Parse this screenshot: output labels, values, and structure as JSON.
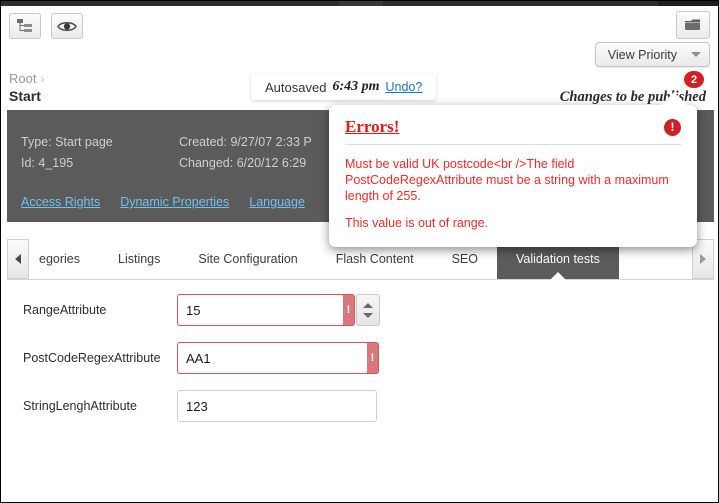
{
  "window": {
    "title": "EPiServer page edit view"
  },
  "toolbar": {
    "tree_button": "tree-structure-icon",
    "preview_button": "eye-icon",
    "folder_button": "folder-icon",
    "collapse_handle": "chevron-down-icon",
    "view_priority": {
      "label": "View Priority",
      "chevron": "chevron-down-icon"
    }
  },
  "breadcrumb": {
    "root": "Root",
    "separator": "›",
    "current": "Start"
  },
  "autosave": {
    "label": "Autosaved",
    "time": "6:43 pm",
    "undo": "Undo?"
  },
  "publish": {
    "status_text": "Changes to be published",
    "badge_count": "2"
  },
  "metadata": {
    "type_label": "Type:",
    "type_value": "Start page",
    "id_label": "Id:",
    "id_value": "4_195",
    "created_label": "Created:",
    "created_value": "9/27/07 2:33 P",
    "changed_label": "Changed:",
    "changed_value": "6/20/12 6:29",
    "links": [
      {
        "label": "Access Rights"
      },
      {
        "label": "Dynamic Properties"
      },
      {
        "label": "Language"
      }
    ]
  },
  "error_popup": {
    "title": "Errors!",
    "icon": "exclamation-icon",
    "messages": [
      "Must be valid UK postcode<br />The field PostCodeRegexAttribute must be a string with a maximum length of 255.",
      "This value is out of range."
    ]
  },
  "tabs": {
    "scroll_left": "arrow-left-icon",
    "scroll_right": "arrow-right-icon",
    "items": [
      {
        "label": "egories",
        "active": false
      },
      {
        "label": "Listings",
        "active": false
      },
      {
        "label": "Site Configuration",
        "active": false
      },
      {
        "label": "Flash Content",
        "active": false
      },
      {
        "label": "SEO",
        "active": false
      },
      {
        "label": "Validation tests",
        "active": true
      }
    ]
  },
  "form": {
    "fields": [
      {
        "label": "RangeAttribute",
        "value": "15",
        "placeholder": "",
        "error": true,
        "error_marker": "!",
        "spinner": true
      },
      {
        "label": "PostCodeRegexAttribute",
        "value": "AA1",
        "placeholder": "",
        "error": true,
        "error_marker": "!",
        "spinner": false
      },
      {
        "label": "StringLenghAttribute",
        "value": "123",
        "placeholder": "",
        "error": false,
        "error_marker": "",
        "spinner": false
      }
    ]
  },
  "colors": {
    "dark_panel": "#5b5b5b",
    "error_red": "#ef2b2b",
    "badge_red": "#cf2026",
    "link_blue": "#6fc3f0",
    "undo_blue": "#1a73c4"
  }
}
